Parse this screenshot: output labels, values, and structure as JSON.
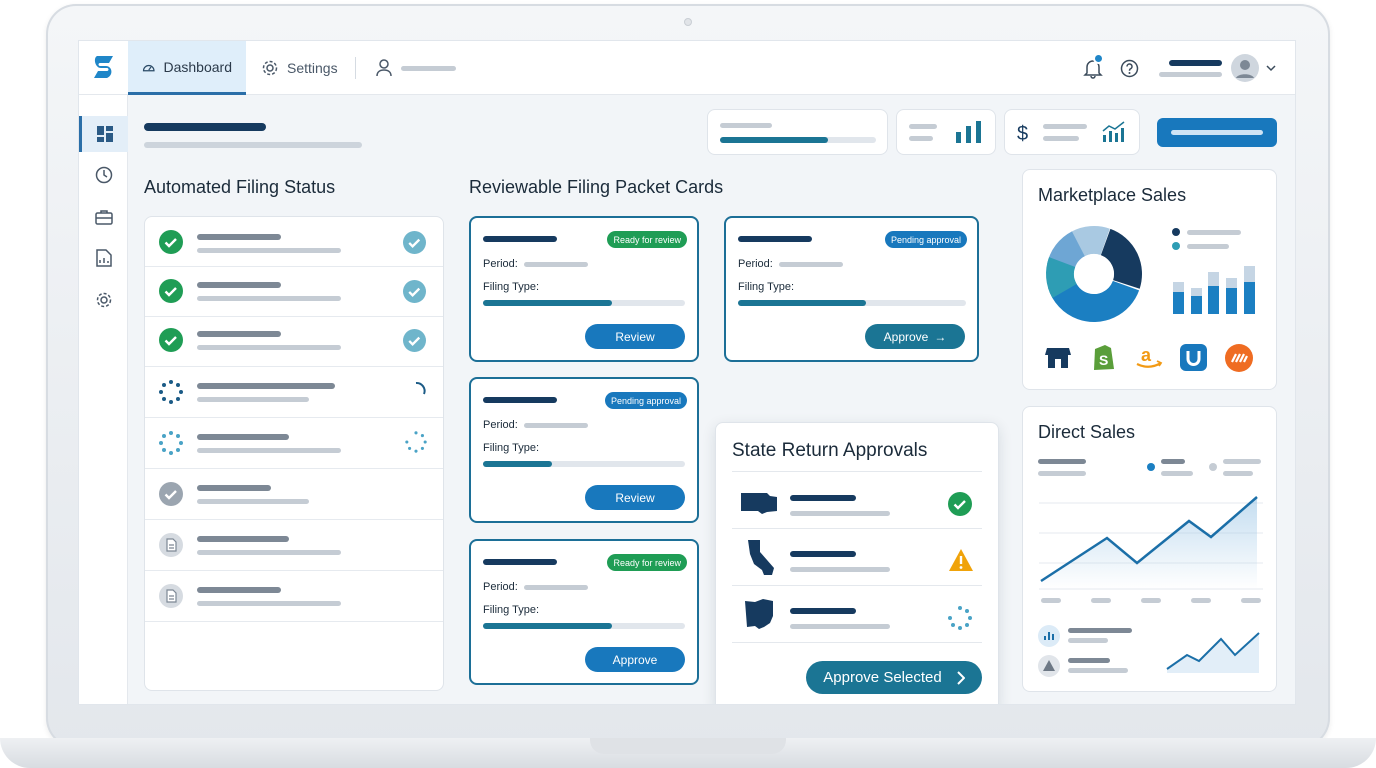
{
  "nav": {
    "dashboard_label": "Dashboard",
    "settings_label": "Settings"
  },
  "sections": {
    "status_title": "Automated Filing Status",
    "packets_title": "Reviewable Filing Packet Cards",
    "state_title": "State Return Approvals",
    "marketplace_title": "Marketplace Sales",
    "direct_title": "Direct Sales"
  },
  "packets": [
    {
      "badge": "Ready for review",
      "badge_color": "#1f9d55",
      "period_label": "Period:",
      "type_label": "Filing Type:",
      "button": "Review",
      "progress": 0.64
    },
    {
      "badge": "Pending approval",
      "badge_color": "#1878bd",
      "period_label": "Period:",
      "type_label": "Filing Type:",
      "button": "Approve",
      "progress": 0.56
    },
    {
      "badge": "Pending approval",
      "badge_color": "#1878bd",
      "period_label": "Period:",
      "type_label": "Filing Type:",
      "button": "Review",
      "progress": 0.34
    },
    {
      "badge": "Ready for review",
      "badge_color": "#1f9d55",
      "period_label": "Period:",
      "type_label": "Filing Type:",
      "button": "Approve",
      "progress": 0.64
    }
  ],
  "state_approvals": {
    "button": "Approve Selected",
    "rows": [
      {
        "state_icon": "montana-icon",
        "status": "complete"
      },
      {
        "state_icon": "california-icon",
        "status": "warning"
      },
      {
        "state_icon": "ohio-icon",
        "status": "pending"
      }
    ]
  },
  "filing_status_rows": [
    "complete",
    "complete",
    "complete",
    "in-progress",
    "in-progress",
    "queued",
    "document",
    "document"
  ],
  "colors": {
    "accent": "#1878bd",
    "teal": "#1b7594",
    "navy": "#163a5f",
    "success": "#1f9d55",
    "warning": "#f0a30a"
  },
  "marketplace_icons": [
    "store-icon",
    "shopify-icon",
    "amazon-icon",
    "u-market-icon",
    "m-market-icon"
  ]
}
